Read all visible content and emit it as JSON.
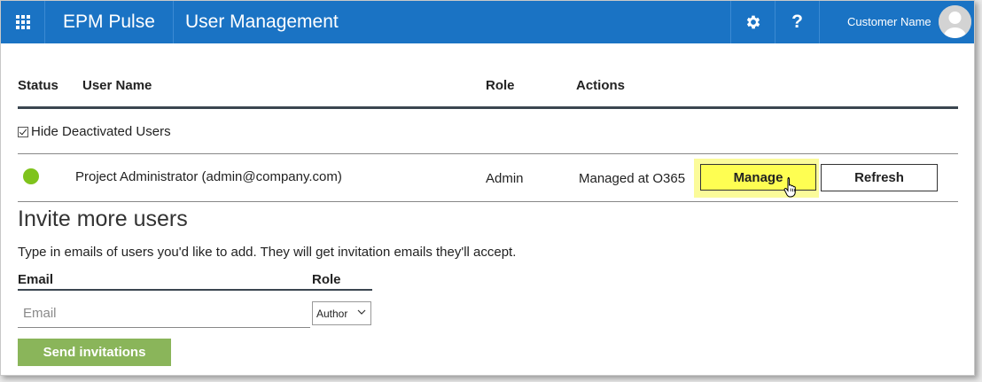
{
  "header": {
    "app_title": "EPM Pulse",
    "page_title": "User Management",
    "user_name": "Customer Name",
    "settings_icon": "gear-icon",
    "help_label": "?",
    "waffle_icon": "app-launcher-icon",
    "bar_color": "#1a73c4"
  },
  "table": {
    "headers": {
      "status": "Status",
      "user_name": "User Name",
      "role": "Role",
      "actions": "Actions"
    },
    "hide_deactivated_label": "Hide Deactivated Users",
    "hide_deactivated_checked": true,
    "rows": [
      {
        "status_color": "#7fc31c",
        "user_name": "Project Administrator (admin@company.com)",
        "role": "Admin",
        "action_text": "Managed at O365",
        "manage_label": "Manage",
        "refresh_label": "Refresh"
      }
    ]
  },
  "invite": {
    "title": "Invite more users",
    "description": "Type in emails of users you'd like to add. They will get invitation emails they'll accept.",
    "email_label": "Email",
    "role_label": "Role",
    "email_value": "",
    "email_placeholder": "Email",
    "role_selected": "Author",
    "send_label": "Send invitations",
    "send_color": "#8ab55a"
  }
}
